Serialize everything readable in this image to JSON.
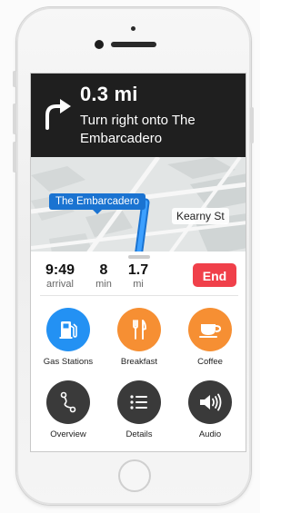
{
  "navigation": {
    "distance": "0.3 mi",
    "instruction": "Turn right onto The Embarcadero"
  },
  "map": {
    "current_street": "The Embarcadero",
    "cross_street": "Kearny St"
  },
  "trip": {
    "arrival_time": "9:49",
    "arrival_label": "arrival",
    "duration_value": "8",
    "duration_unit": "min",
    "distance_value": "1.7",
    "distance_unit": "mi",
    "end_label": "End"
  },
  "actions": [
    {
      "label": "Gas Stations",
      "icon": "gas-pump-icon",
      "color": "#2391f3"
    },
    {
      "label": "Breakfast",
      "icon": "fork-knife-icon",
      "color": "#f68f33"
    },
    {
      "label": "Coffee",
      "icon": "coffee-cup-icon",
      "color": "#f68f33"
    },
    {
      "label": "Overview",
      "icon": "route-icon",
      "color": "#3a3a3a"
    },
    {
      "label": "Details",
      "icon": "list-icon",
      "color": "#3a3a3a"
    },
    {
      "label": "Audio",
      "icon": "speaker-icon",
      "color": "#3a3a3a"
    }
  ],
  "colors": {
    "end_button": "#f0404a",
    "route_blue": "#1a73d1",
    "banner": "#1f1f1f"
  }
}
